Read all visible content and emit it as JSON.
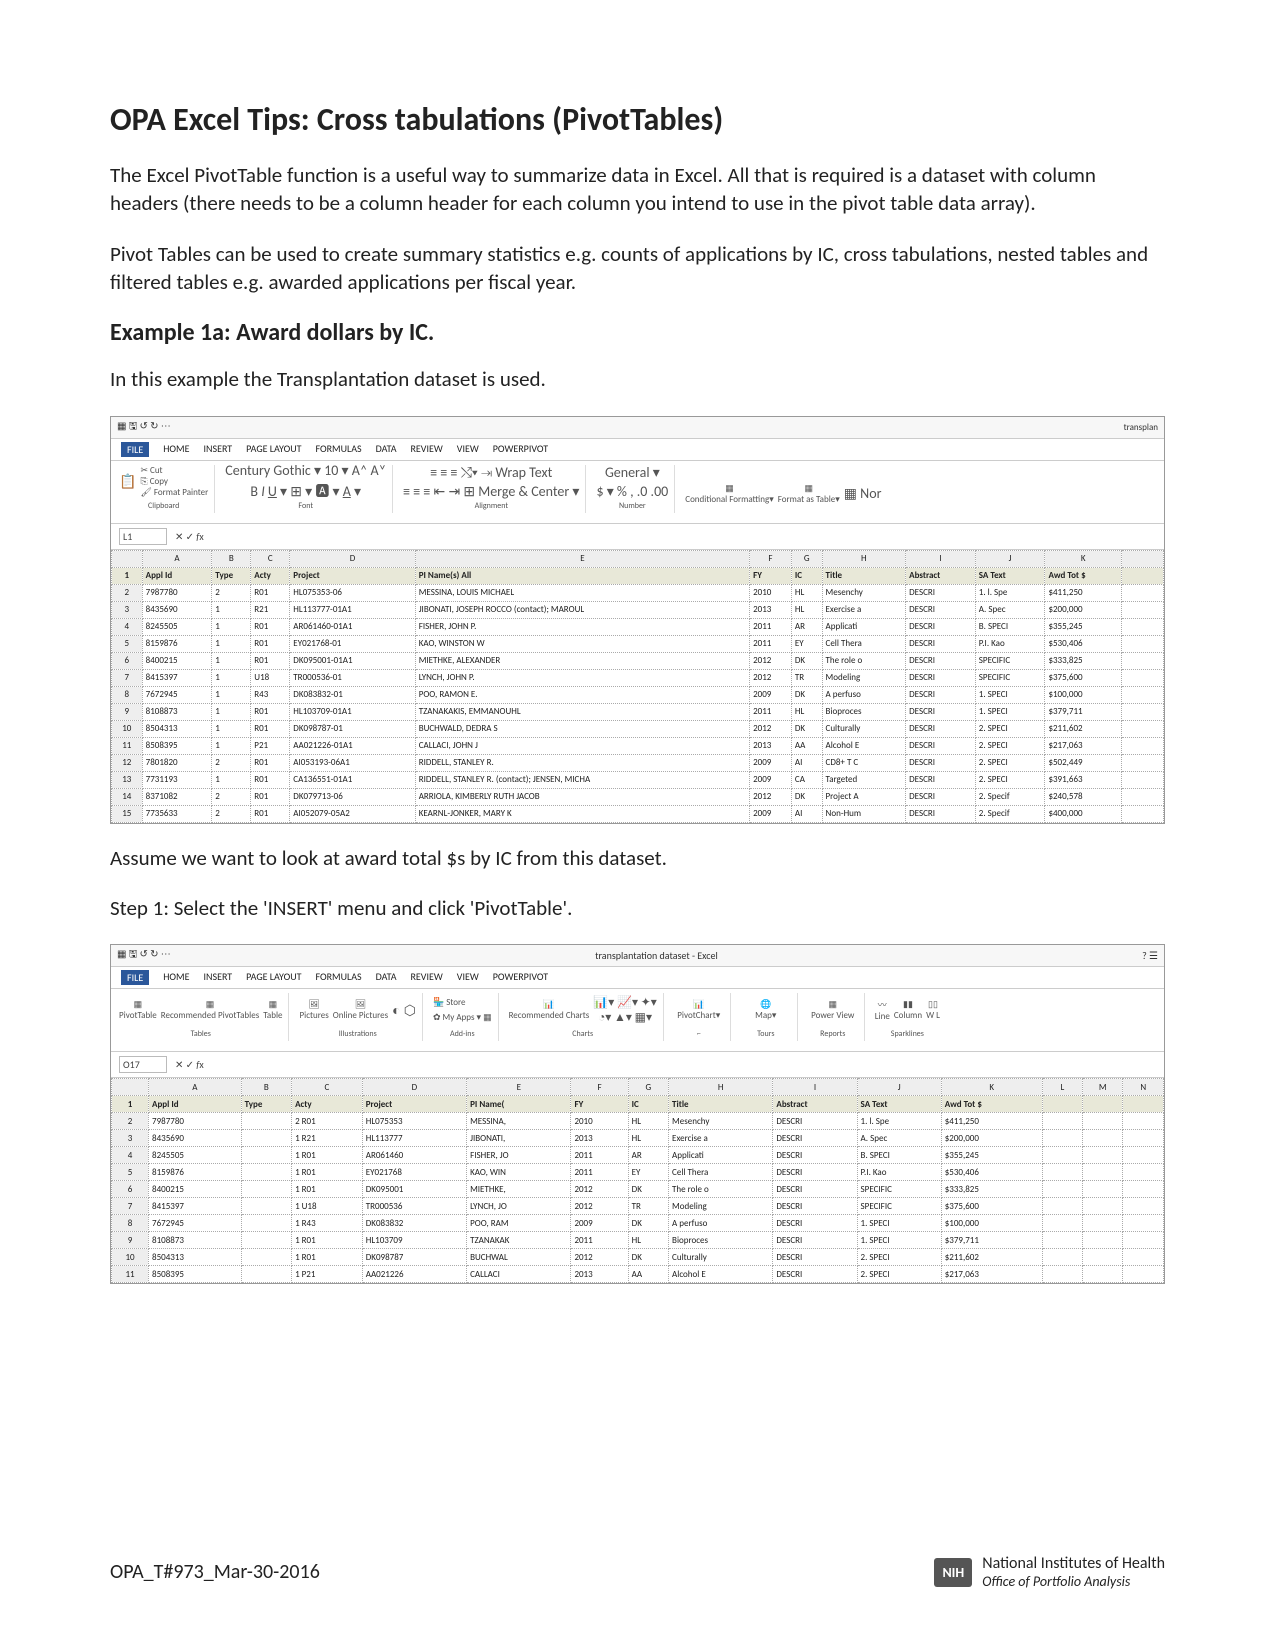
{
  "title": "OPA Excel Tips: Cross tabulations (PivotTables)",
  "para1": "The Excel PivotTable function is a useful way to summarize data in Excel.  All that is required is a dataset with column headers (there needs to be a column header for each column you intend to use in the pivot table data array).",
  "para2": "Pivot Tables can be used to create summary statistics e.g. counts of applications by IC, cross tabulations, nested tables and filtered tables e.g. awarded applications per fiscal year.",
  "example_heading": "Example 1a: Award dollars by IC.",
  "example_intro": "In this example the Transplantation dataset is used.",
  "assume_line": "Assume we want to look at award total $s by IC from this dataset.",
  "step1": "Step 1: Select the 'INSERT' menu and click 'PivotTable'.",
  "footer_id": "OPA_T#973_Mar-30-2016",
  "footer_org1": "National Institutes of Health",
  "footer_org2": "Office of Portfolio Analysis",
  "nih_logo": "NIH",
  "excel1": {
    "title_suffix": "transplan",
    "tabs": [
      "FILE",
      "HOME",
      "INSERT",
      "PAGE LAYOUT",
      "FORMULAS",
      "DATA",
      "REVIEW",
      "VIEW",
      "POWERPIVOT"
    ],
    "active_tab": "FILE",
    "clipboard": {
      "cut": "Cut",
      "copy": "Copy",
      "painter": "Format Painter",
      "paste": "Paste",
      "label": "Clipboard"
    },
    "font": {
      "name": "Century Gothic",
      "size": "10",
      "label": "Font"
    },
    "alignment": {
      "wrap": "Wrap Text",
      "merge": "Merge & Center",
      "label": "Alignment"
    },
    "number": {
      "format": "General",
      "label": "Number"
    },
    "styles": {
      "cond": "Conditional Formatting",
      "fmt": "Format as Table",
      "label": ""
    },
    "namebox": "L1",
    "cols": [
      "",
      "A",
      "B",
      "C",
      "D",
      "E",
      "F",
      "G",
      "H",
      "I",
      "J",
      "K",
      ""
    ],
    "header_row": [
      "1",
      "Appl Id",
      "Type",
      "Acty",
      "Project",
      "PI Name(s) All",
      "FY",
      "IC",
      "Title",
      "Abstract",
      "SA Text",
      "Awd Tot $",
      ""
    ],
    "rows": [
      [
        "2",
        "7987780",
        "2",
        "R01",
        "HL075353-06",
        "MESSINA, LOUIS MICHAEL",
        "2010",
        "HL",
        "Mesenchy",
        "DESCRI",
        "1. l. Spe",
        "$411,250",
        ""
      ],
      [
        "3",
        "8435690",
        "1",
        "R21",
        "HL113777-01A1",
        "JIBONATI, JOSEPH ROCCO (contact); MAROUL",
        "2013",
        "HL",
        "Exercise a",
        "DESCRI",
        "A. Spec",
        "$200,000",
        ""
      ],
      [
        "4",
        "8245505",
        "1",
        "R01",
        "AR061460-01A1",
        "FISHER, JOHN P.",
        "2011",
        "AR",
        "Applicati",
        "DESCRI",
        "B. SPECI",
        "$355,245",
        ""
      ],
      [
        "5",
        "8159876",
        "1",
        "R01",
        "EY021768-01",
        "KAO, WINSTON W",
        "2011",
        "EY",
        "Cell Thera",
        "DESCRI",
        "P.I. Kao",
        "$530,406",
        ""
      ],
      [
        "6",
        "8400215",
        "1",
        "R01",
        "DK095001-01A1",
        "MIETHKE, ALEXANDER",
        "2012",
        "DK",
        "The role o",
        "DESCRI",
        "SPECIFIC",
        "$333,825",
        ""
      ],
      [
        "7",
        "8415397",
        "1",
        "U18",
        "TR000536-01",
        "LYNCH, JOHN P.",
        "2012",
        "TR",
        "Modeling",
        "DESCRI",
        "SPECIFIC",
        "$375,600",
        ""
      ],
      [
        "8",
        "7672945",
        "1",
        "R43",
        "DK083832-01",
        "POO, RAMON E.",
        "2009",
        "DK",
        "A perfuso",
        "DESCRI",
        "1. SPECI",
        "$100,000",
        ""
      ],
      [
        "9",
        "8108873",
        "1",
        "R01",
        "HL103709-01A1",
        "TZANAKAKIS, EMMANOUHL",
        "2011",
        "HL",
        "Bioproces",
        "DESCRI",
        "1. SPECI",
        "$379,711",
        ""
      ],
      [
        "10",
        "8504313",
        "1",
        "R01",
        "DK098787-01",
        "BUCHWALD, DEDRA S",
        "2012",
        "DK",
        "Culturally",
        "DESCRI",
        "2. SPECI",
        "$211,602",
        ""
      ],
      [
        "11",
        "8508395",
        "1",
        "P21",
        "AA021226-01A1",
        "CALLACI, JOHN J",
        "2013",
        "AA",
        "Alcohol E",
        "DESCRI",
        "2. SPECI",
        "$217,063",
        ""
      ],
      [
        "12",
        "7801820",
        "2",
        "R01",
        "AI053193-06A1",
        "RIDDELL, STANLEY R.",
        "2009",
        "AI",
        "CD8+ T C",
        "DESCRI",
        "2. SPECI",
        "$502,449",
        ""
      ],
      [
        "13",
        "7731193",
        "1",
        "R01",
        "CA136551-01A1",
        "RIDDELL, STANLEY R. (contact); JENSEN, MICHA",
        "2009",
        "CA",
        "Targeted",
        "DESCRI",
        "2. SPECI",
        "$391,663",
        ""
      ],
      [
        "14",
        "8371082",
        "2",
        "R01",
        "DK079713-06",
        "ARRIOLA, KIMBERLY RUTH JACOB",
        "2012",
        "DK",
        "Project A",
        "DESCRI",
        "2. Specif",
        "$240,578",
        ""
      ],
      [
        "15",
        "7735633",
        "2",
        "R01",
        "AI052079-05A2",
        "KEARNL-JONKER, MARY K",
        "2009",
        "AI",
        "Non-Hum",
        "DESCRI",
        "2. Specif",
        "$400,000",
        ""
      ]
    ]
  },
  "excel2": {
    "title_center": "transplantation dataset - Excel",
    "tabs": [
      "FILE",
      "HOME",
      "INSERT",
      "PAGE LAYOUT",
      "FORMULAS",
      "DATA",
      "REVIEW",
      "VIEW",
      "POWERPIVOT"
    ],
    "active_tab": "FILE",
    "groups": {
      "tables": {
        "pivot": "PivotTable",
        "rec": "Recommended PivotTables",
        "table": "Table",
        "label": "Tables"
      },
      "illus": {
        "pics": "Pictures",
        "online": "Online Pictures",
        "label": "Illustrations"
      },
      "addins": {
        "store": "Store",
        "myapps": "My Apps",
        "label": "Add-ins"
      },
      "charts": {
        "rec": "Recommended Charts",
        "label": "Charts"
      },
      "pivotchart": "PivotChart",
      "map": "Map",
      "tours": "Tours",
      "power": {
        "pv": "Power View",
        "label": "Reports"
      },
      "spark": {
        "line": "Line",
        "col": "Column",
        "wl": "W L",
        "label": "Sparklines"
      }
    },
    "namebox": "O17",
    "cols": [
      "",
      "A",
      "B",
      "C",
      "D",
      "E",
      "F",
      "G",
      "H",
      "I",
      "J",
      "K",
      "L",
      "M",
      "N"
    ],
    "header_row": [
      "1",
      "Appl Id",
      "Type",
      "Acty",
      "Project",
      "PI Name(",
      "FY",
      "IC",
      "Title",
      "Abstract",
      "SA Text",
      "Awd Tot $",
      "",
      "",
      ""
    ],
    "rows": [
      [
        "2",
        "7987780",
        "",
        "2 R01",
        "HL075353",
        "MESSINA,",
        "2010",
        "HL",
        "Mesenchy",
        "DESCRI",
        "1. l. Spe",
        "$411,250",
        "",
        "",
        ""
      ],
      [
        "3",
        "8435690",
        "",
        "1 R21",
        "HL113777",
        "JIBONATI,",
        "2013",
        "HL",
        "Exercise a",
        "DESCRI",
        "A. Spec",
        "$200,000",
        "",
        "",
        ""
      ],
      [
        "4",
        "8245505",
        "",
        "1 R01",
        "AR061460",
        "FISHER, JO",
        "2011",
        "AR",
        "Applicati",
        "DESCRI",
        "B. SPECI",
        "$355,245",
        "",
        "",
        ""
      ],
      [
        "5",
        "8159876",
        "",
        "1 R01",
        "EY021768",
        "KAO, WIN",
        "2011",
        "EY",
        "Cell Thera",
        "DESCRI",
        "P.I. Kao",
        "$530,406",
        "",
        "",
        ""
      ],
      [
        "6",
        "8400215",
        "",
        "1 R01",
        "DK095001",
        "MIETHKE,",
        "2012",
        "DK",
        "The role o",
        "DESCRI",
        "SPECIFIC",
        "$333,825",
        "",
        "",
        ""
      ],
      [
        "7",
        "8415397",
        "",
        "1 U18",
        "TR000536",
        "LYNCH, JO",
        "2012",
        "TR",
        "Modeling",
        "DESCRI",
        "SPECIFIC",
        "$375,600",
        "",
        "",
        ""
      ],
      [
        "8",
        "7672945",
        "",
        "1 R43",
        "DK083832",
        "POO, RAM",
        "2009",
        "DK",
        "A perfuso",
        "DESCRI",
        "1. SPECI",
        "$100,000",
        "",
        "",
        ""
      ],
      [
        "9",
        "8108873",
        "",
        "1 R01",
        "HL103709",
        "TZANAKAK",
        "2011",
        "HL",
        "Bioproces",
        "DESCRI",
        "1. SPECI",
        "$379,711",
        "",
        "",
        ""
      ],
      [
        "10",
        "8504313",
        "",
        "1 R01",
        "DK098787",
        "BUCHWAL",
        "2012",
        "DK",
        "Culturally",
        "DESCRI",
        "2. SPECI",
        "$211,602",
        "",
        "",
        ""
      ],
      [
        "11",
        "8508395",
        "",
        "1 P21",
        "AA021226",
        "CALLACI",
        "2013",
        "AA",
        "Alcohol E",
        "DESCRI",
        "2. SPECI",
        "$217,063",
        "",
        "",
        ""
      ]
    ]
  }
}
